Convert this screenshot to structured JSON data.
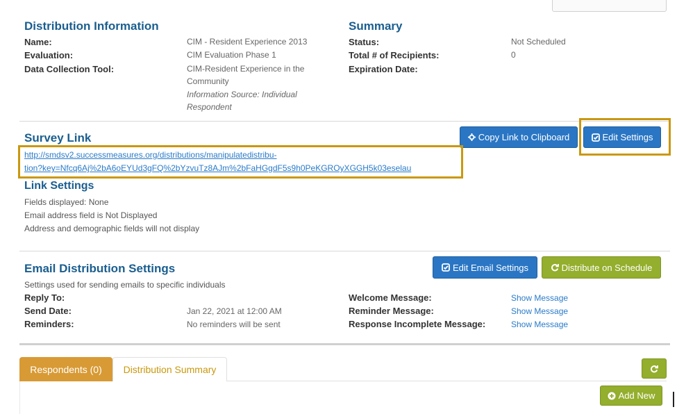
{
  "distribution": {
    "heading": "Distribution Information",
    "rows": [
      {
        "label": "Name:",
        "value": "CIM - Resident Experience 2013"
      },
      {
        "label": "Evaluation:",
        "value": "CIM Evaluation Phase 1"
      },
      {
        "label": "Data Collection Tool:",
        "value_line1": "CIM-Resident Experience in the",
        "value_line2": "Community",
        "note_line1": "Information Source: Individual",
        "note_line2": "Respondent"
      }
    ]
  },
  "summary": {
    "heading": "Summary",
    "status_label": "Status:",
    "status_value": "Not Scheduled",
    "recipients_label": "Total # of Recipients:",
    "recipients_value": "0",
    "expiration_label": "Expiration Date:"
  },
  "survey_link": {
    "heading": "Survey Link",
    "url_line1": "http://smdsv2.successmeasures.org/distributions/manipulatedistribu-",
    "url_line2": "tion?key=Nfcq6Aj%2bA6oEYUd3gFQ%2bYzvuTz8AJm%2bFaHGgdF5s9h0PeKGROyXGGH5k03eselau",
    "copy_button": "Copy Link to Clipboard",
    "edit_button": "Edit Settings"
  },
  "link_settings": {
    "heading": "Link Settings",
    "lines": [
      "Fields displayed: None",
      "Email address field is Not Displayed",
      "Address and demographic fields will not display"
    ]
  },
  "email": {
    "heading": "Email Distribution Settings",
    "edit_button": "Edit Email Settings",
    "schedule_button": "Distribute on Schedule",
    "description": "Settings used for sending emails to specific individuals",
    "reply_label": "Reply To:",
    "send_label": "Send Date:",
    "send_value": "Jan 22, 2021 at 12:00 AM",
    "reminders_label": "Reminders:",
    "reminders_value": "No reminders will be sent",
    "welcome_label": "Welcome Message:",
    "reminder_msg_label": "Reminder Message:",
    "incomplete_label": "Response Incomplete Message:",
    "show_message": "Show Message"
  },
  "tabs": [
    {
      "label": "Respondents (0)"
    },
    {
      "label": "Distribution Summary"
    }
  ],
  "add_new_button": "Add New",
  "colors": {
    "heading_blue": "#1a5e8f",
    "button_blue": "#2a76c4",
    "button_olive": "#94ae2d",
    "tab_active": "#d89a35",
    "highlight": "#c9980e"
  }
}
